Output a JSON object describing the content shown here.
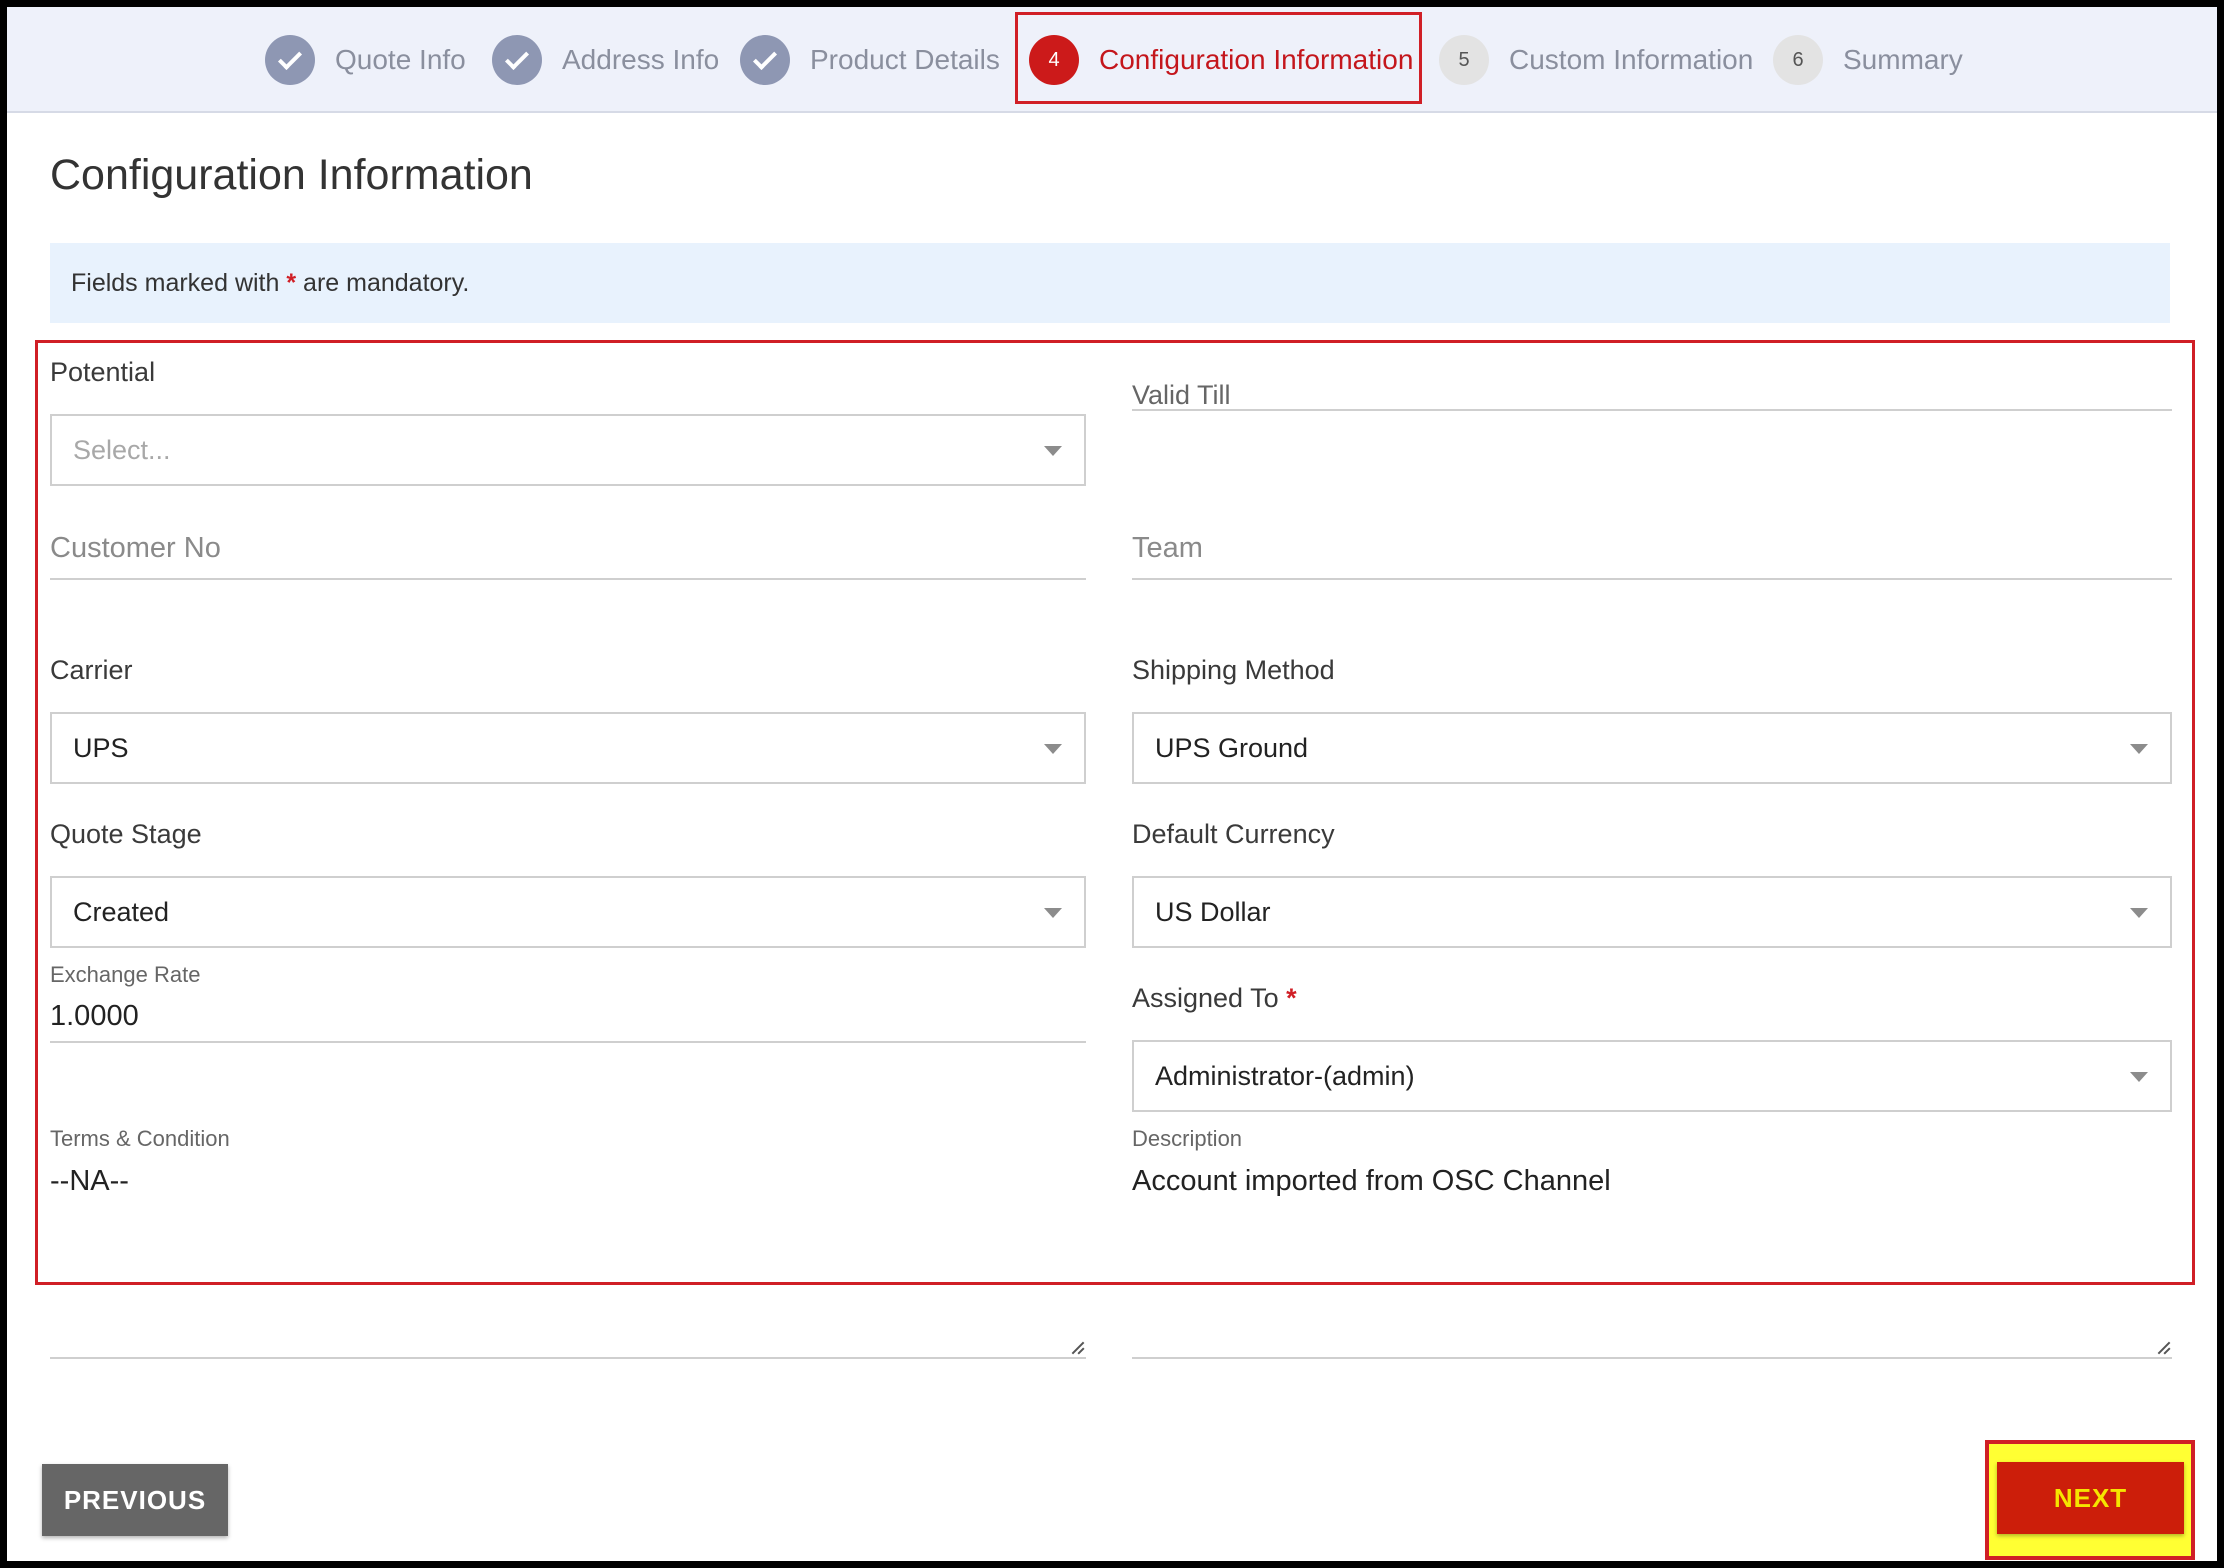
{
  "stepper": {
    "steps": [
      {
        "number": "",
        "label": "Quote Info",
        "status": "done"
      },
      {
        "number": "",
        "label": "Address Info",
        "status": "done"
      },
      {
        "number": "",
        "label": "Product Details",
        "status": "done"
      },
      {
        "number": "4",
        "label": "Configuration Information",
        "status": "current"
      },
      {
        "number": "5",
        "label": "Custom Information",
        "status": "todo"
      },
      {
        "number": "6",
        "label": "Summary",
        "status": "todo"
      }
    ]
  },
  "page_title": "Configuration Information",
  "notice": {
    "prefix": "Fields marked with",
    "star": "*",
    "suffix": "are mandatory."
  },
  "form": {
    "potential": {
      "label": "Potential",
      "placeholder": "Select..."
    },
    "valid_till": {
      "label": "Valid Till"
    },
    "customer_no": {
      "label": "Customer No"
    },
    "team": {
      "label": "Team"
    },
    "carrier": {
      "label": "Carrier",
      "value": "UPS"
    },
    "shipping_method": {
      "label": "Shipping Method",
      "value": "UPS Ground"
    },
    "quote_stage": {
      "label": "Quote Stage",
      "value": "Created"
    },
    "default_currency": {
      "label": "Default Currency",
      "value": "US Dollar"
    },
    "exchange_rate": {
      "label": "Exchange Rate",
      "value": "1.0000"
    },
    "assigned_to": {
      "label": "Assigned To",
      "required_mark": "*",
      "value": "Administrator-(admin)"
    },
    "terms": {
      "label": "Terms & Condition",
      "value": "--NA--"
    },
    "description": {
      "label": "Description",
      "value": "Account imported from OSC Channel"
    }
  },
  "buttons": {
    "previous": "PREVIOUS",
    "next": "NEXT"
  },
  "colors": {
    "accent": "#cc1a1a",
    "highlight": "#ffff33",
    "notice_bg": "#e8f2fd"
  }
}
